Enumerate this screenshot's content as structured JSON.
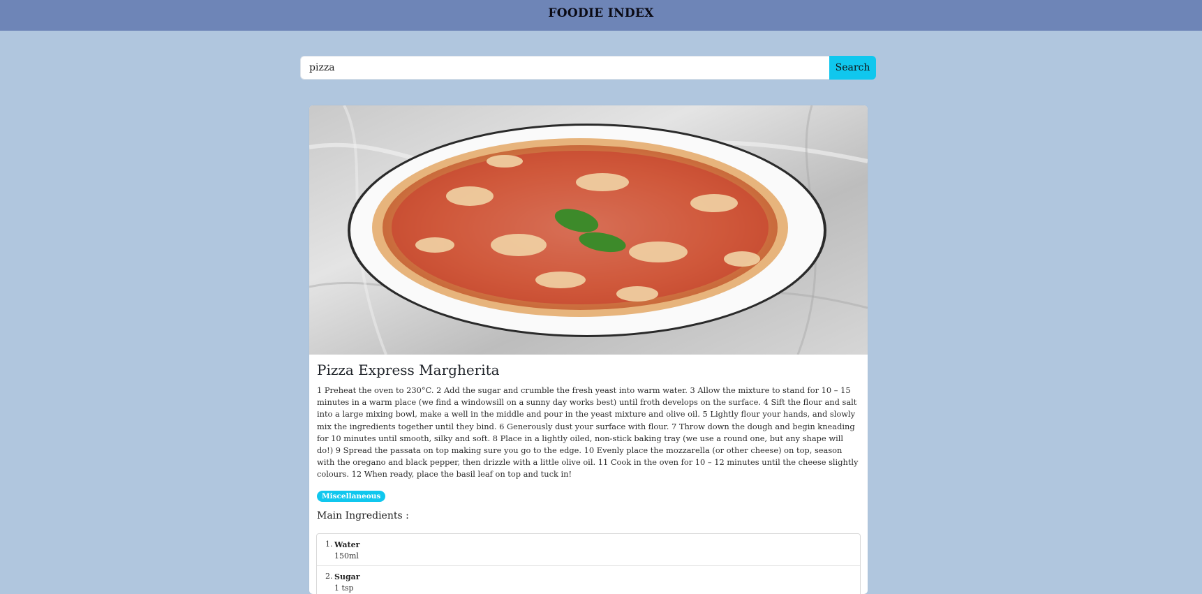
{
  "navbar": {
    "brand": "FOODIE INDEX"
  },
  "search": {
    "value": "pizza",
    "button_label": "Search"
  },
  "recipe": {
    "title": "Pizza Express Margherita",
    "image_alt": "Margherita pizza with basil leaf on white plate over marble",
    "instructions": "1 Preheat the oven to 230°C. 2 Add the sugar and crumble the fresh yeast into warm water. 3 Allow the mixture to stand for 10 – 15 minutes in a warm place (we find a windowsill on a sunny day works best) until froth develops on the surface. 4 Sift the flour and salt into a large mixing bowl, make a well in the middle and pour in the yeast mixture and olive oil. 5 Lightly flour your hands, and slowly mix the ingredients together until they bind. 6 Generously dust your surface with flour. 7 Throw down the dough and begin kneading for 10 minutes until smooth, silky and soft. 8 Place in a lightly oiled, non-stick baking tray (we use a round one, but any shape will do!) 9 Spread the passata on top making sure you go to the edge. 10 Evenly place the mozzarella (or other cheese) on top, season with the oregano and black pepper, then drizzle with a little olive oil. 11 Cook in the oven for 10 – 12 minutes until the cheese slightly colours. 12 When ready, place the basil leaf on top and tuck in!",
    "category": "Miscellaneous",
    "ingredients_heading": "Main Ingredients :",
    "ingredients": [
      {
        "num": "1.",
        "name": "Water",
        "measure": "150ml"
      },
      {
        "num": "2.",
        "name": "Sugar",
        "measure": "1 tsp"
      }
    ]
  },
  "colors": {
    "page_bg": "#b0c6de",
    "navbar_bg": "#6e85b7",
    "accent": "#10c7ee"
  }
}
